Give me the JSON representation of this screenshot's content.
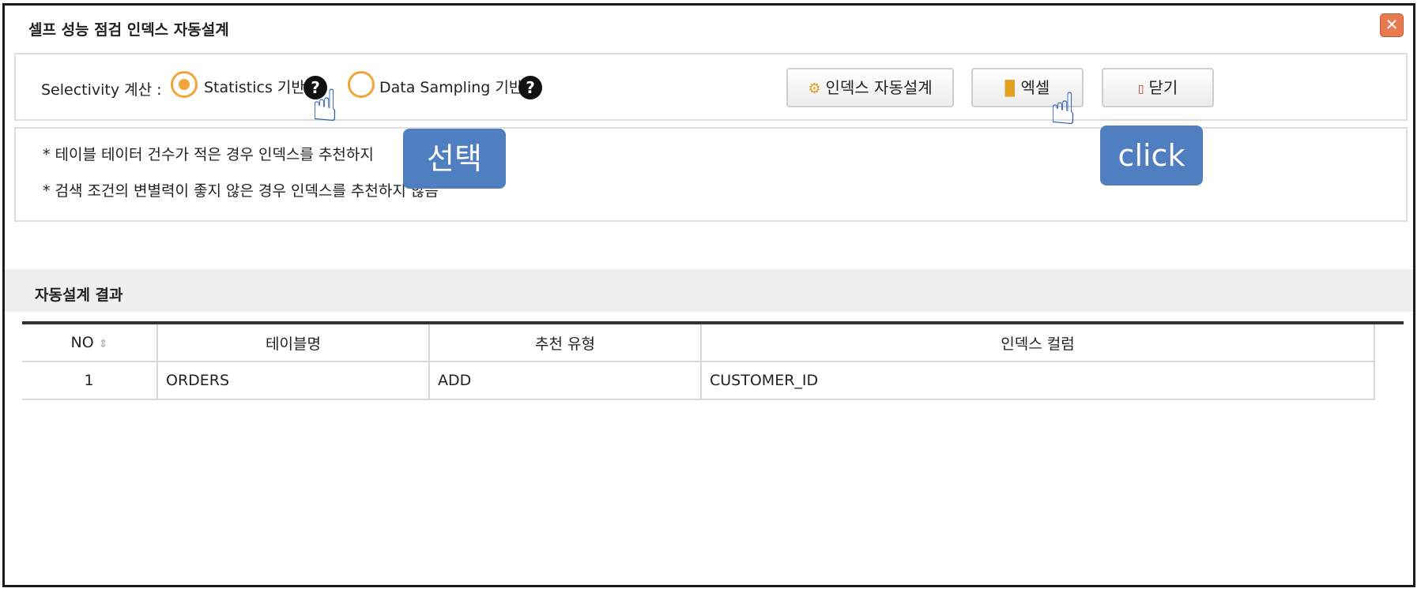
{
  "window": {
    "title": "셀프 성능 점검 인덱스 자동설계",
    "close_label": "✕"
  },
  "options": {
    "selectivity_label": "Selectivity 계산 :",
    "radio_statistics": "Statistics 기반",
    "radio_sampling": "Data Sampling 기반",
    "selected": "Statistics 기반",
    "help_glyph": "?"
  },
  "buttons": {
    "auto_design": "인덱스 자동설계",
    "excel": "엑셀",
    "close": "닫기"
  },
  "notes": [
    "* 테이블 테이터 건수가 적은 경우 인덱스를 추천하지",
    "* 검색 조건의 변별력이 좋지 않은 경우 인덱스를 추천하지 않음"
  ],
  "annotations": {
    "select_callout": "선택",
    "click_callout": "click"
  },
  "section": {
    "title": "자동설계 결과"
  },
  "table": {
    "columns": [
      "NO",
      "테이블명",
      "추천 유형",
      "인덱스 컬럼"
    ],
    "rows": [
      {
        "no": "1",
        "table_name": "ORDERS",
        "type": "ADD",
        "columns": "CUSTOMER_ID"
      }
    ]
  },
  "colors": {
    "accent_radio": "#f0a43a",
    "callout_bg": "#4f7fc0",
    "close_button": "#e87a4f"
  },
  "icons": {
    "auto_design": "gears-icon",
    "excel": "excel-file-icon",
    "close": "close-door-icon",
    "sort": "sort-icon",
    "help": "help-icon",
    "pointer": "hand-pointer-icon"
  }
}
